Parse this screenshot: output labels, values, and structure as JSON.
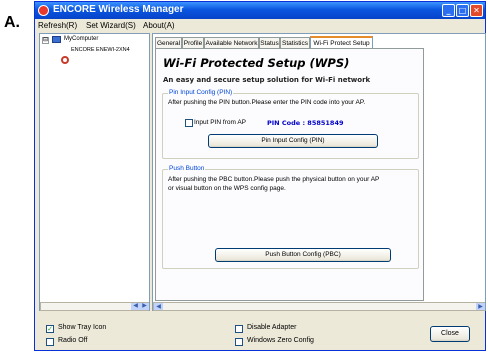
{
  "figure_label": "A.",
  "window": {
    "title": "ENCORE Wireless Manager",
    "app_icon": "encore-logo-icon",
    "controls": [
      "minimize-icon",
      "maximize-icon",
      "close-icon"
    ]
  },
  "menubar": {
    "items": [
      {
        "label": "Refresh(R)"
      },
      {
        "label": "Set Wizard(S)"
      },
      {
        "label": "About(A)"
      }
    ]
  },
  "tree": {
    "root": {
      "label": "MyComputer",
      "expander": "⊟",
      "icon": "computer-icon"
    },
    "child": {
      "label": "ENCORE ENEWI-2XN4",
      "icon": "wireless-adapter-icon"
    }
  },
  "tabs": [
    {
      "label": "General"
    },
    {
      "label": "Profile"
    },
    {
      "label": "Available Network"
    },
    {
      "label": "Status"
    },
    {
      "label": "Statistics"
    },
    {
      "label": "Wi-Fi Protect Setup",
      "active": true
    }
  ],
  "wps": {
    "heading": "Wi-Fi Protected Setup (WPS)",
    "subtitle": "An easy and secure setup solution for Wi-Fi network",
    "pin_group": {
      "legend": "Pin Input Config (PIN)",
      "instruction": "After pushing the PIN button.Please enter the PIN code into your AP.",
      "checkbox_label": "Input PIN from AP",
      "checkbox_checked": false,
      "pin_code_label": "PIN Code : 85851849",
      "button_label": "Pin Input Config (PIN)"
    },
    "pbc_group": {
      "legend": "Push Button",
      "instruction_line1": "After pushing the PBC button.Please push the physical button on your AP",
      "instruction_line2": "or visual button on the WPS config page.",
      "button_label": "Push Button Config (PBC)"
    }
  },
  "bottom": {
    "show_tray_icon": {
      "label": "Show Tray Icon",
      "checked": true
    },
    "radio_off": {
      "label": "Radio Off",
      "checked": false
    },
    "disable_adapter": {
      "label": "Disable Adapter",
      "checked": false
    },
    "windows_zero_config": {
      "label": "Windows Zero Config",
      "checked": false
    },
    "close_button": "Close"
  },
  "colors": {
    "title_bar": "#0a56e0",
    "pin_code_text": "#0000cc",
    "group_legend": "#0046d5",
    "window_background": "#ece9d8"
  }
}
